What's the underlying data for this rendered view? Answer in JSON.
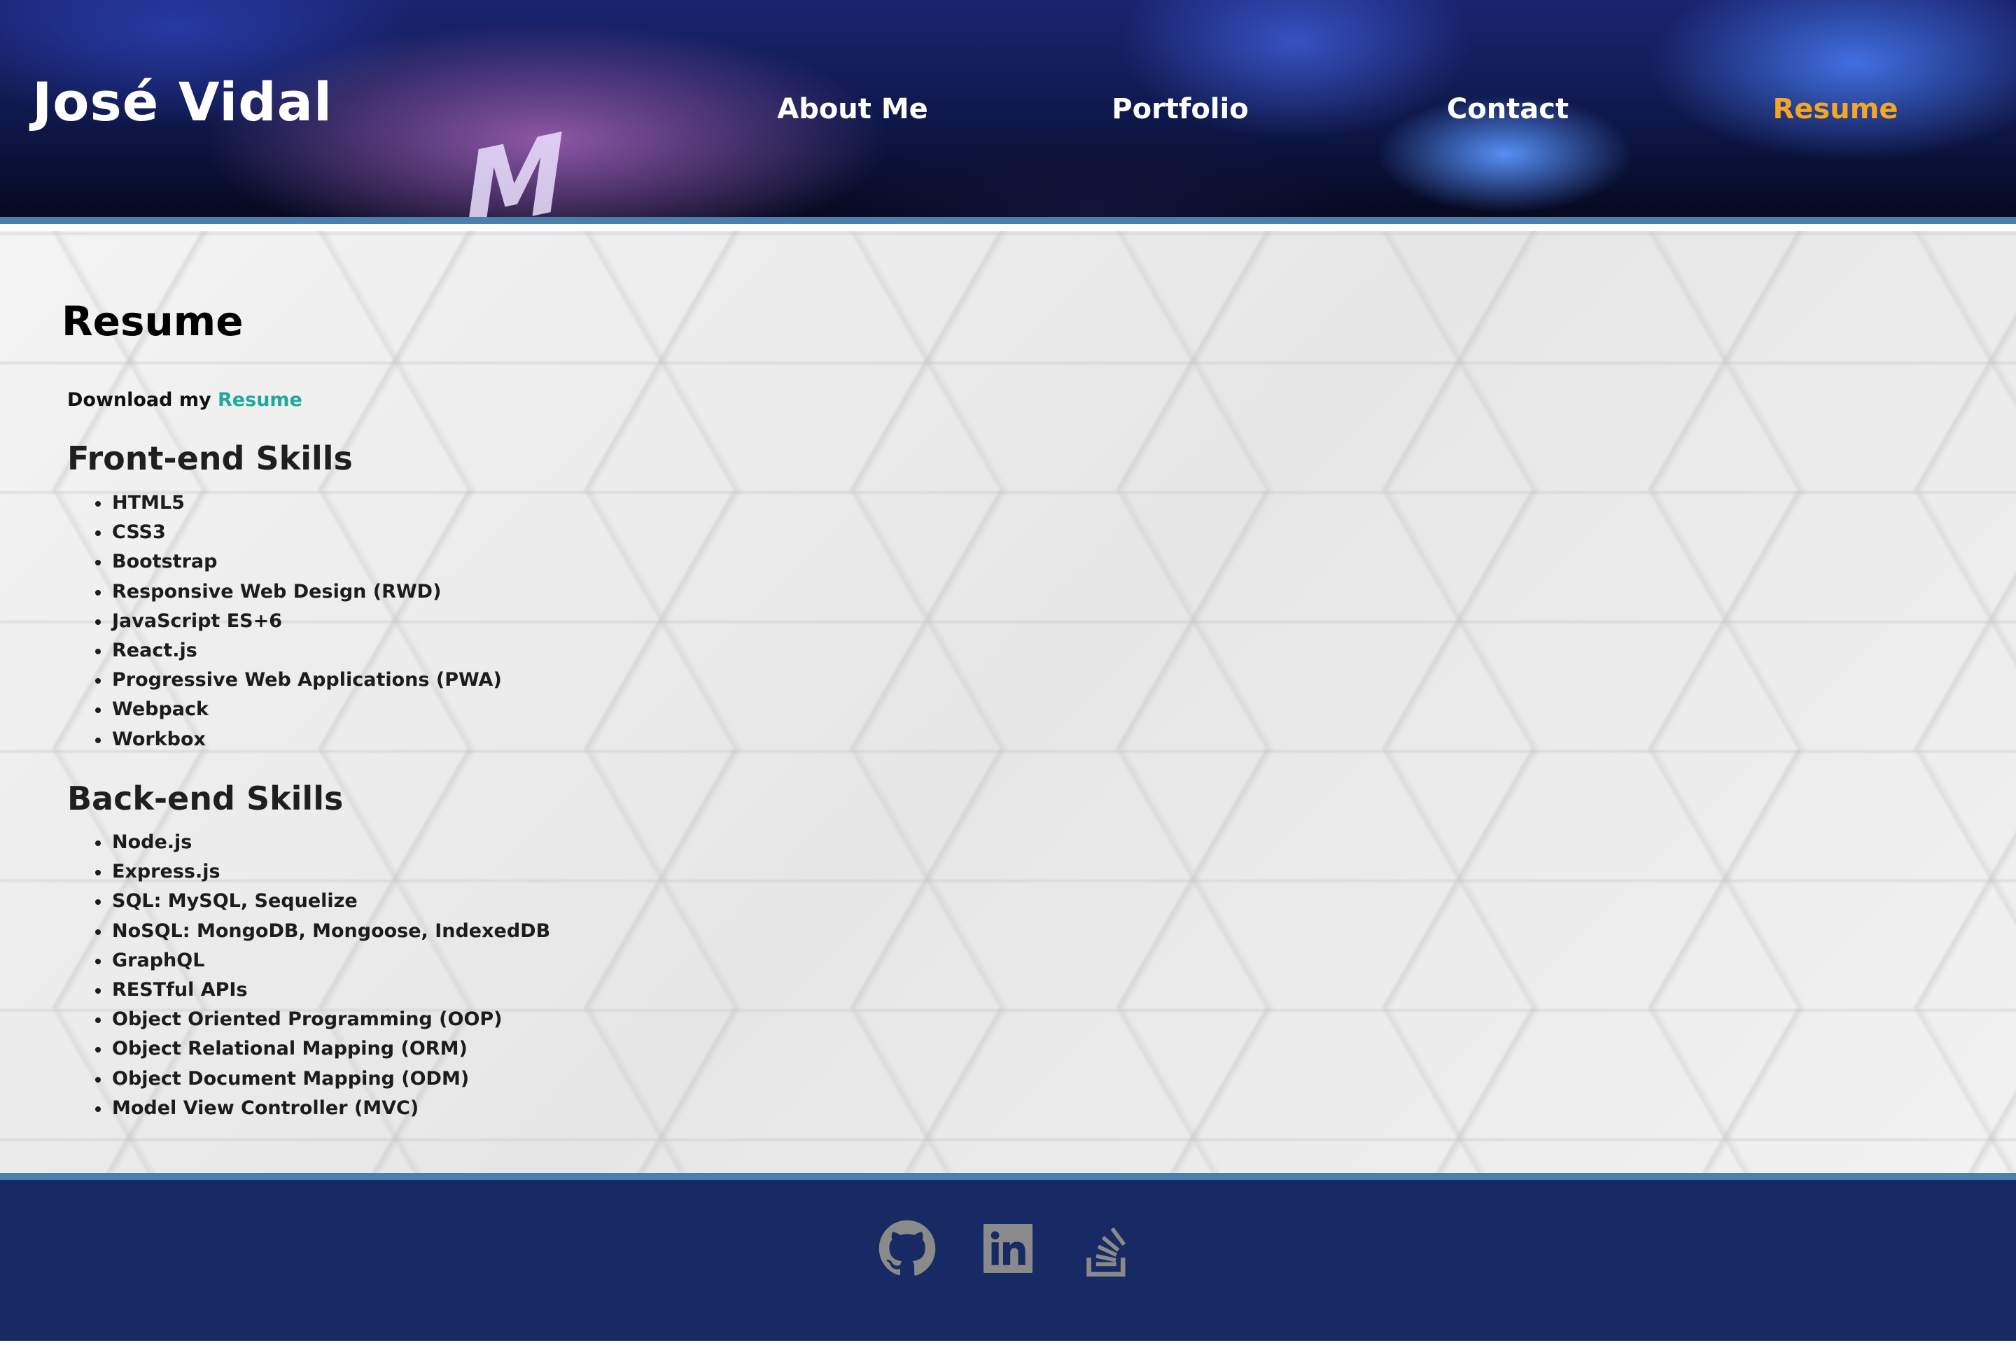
{
  "header": {
    "brand": "José Vidal",
    "key_letter": "M",
    "nav": [
      {
        "label": "About Me"
      },
      {
        "label": "Portfolio"
      },
      {
        "label": "Contact"
      },
      {
        "label": "Resume",
        "active": true
      }
    ],
    "active_color": "#f5a623"
  },
  "main": {
    "title": "Resume",
    "download": {
      "prefix": "Download my ",
      "link_label": "Resume",
      "link_color": "#20a89a"
    },
    "frontend": {
      "title": "Front-end Skills",
      "items": [
        "HTML5",
        "CSS3",
        "Bootstrap",
        "Responsive Web Design (RWD)",
        "JavaScript ES+6",
        "React.js",
        "Progressive Web Applications (PWA)",
        "Webpack",
        "Workbox"
      ]
    },
    "backend": {
      "title": "Back-end Skills",
      "items": [
        "Node.js",
        "Express.js",
        "SQL: MySQL, Sequelize",
        "NoSQL: MongoDB, Mongoose, IndexedDB",
        "GraphQL",
        "RESTful APIs",
        "Object Oriented Programming (OOP)",
        "Object Relational Mapping (ORM)",
        "Object Document Mapping (ODM)",
        "Model View Controller (MVC)"
      ]
    }
  },
  "footer": {
    "background": "#172a63",
    "icons": [
      {
        "name": "github-icon"
      },
      {
        "name": "linkedin-icon"
      },
      {
        "name": "stackoverflow-icon"
      }
    ],
    "icon_color": "#8a8a8a"
  }
}
